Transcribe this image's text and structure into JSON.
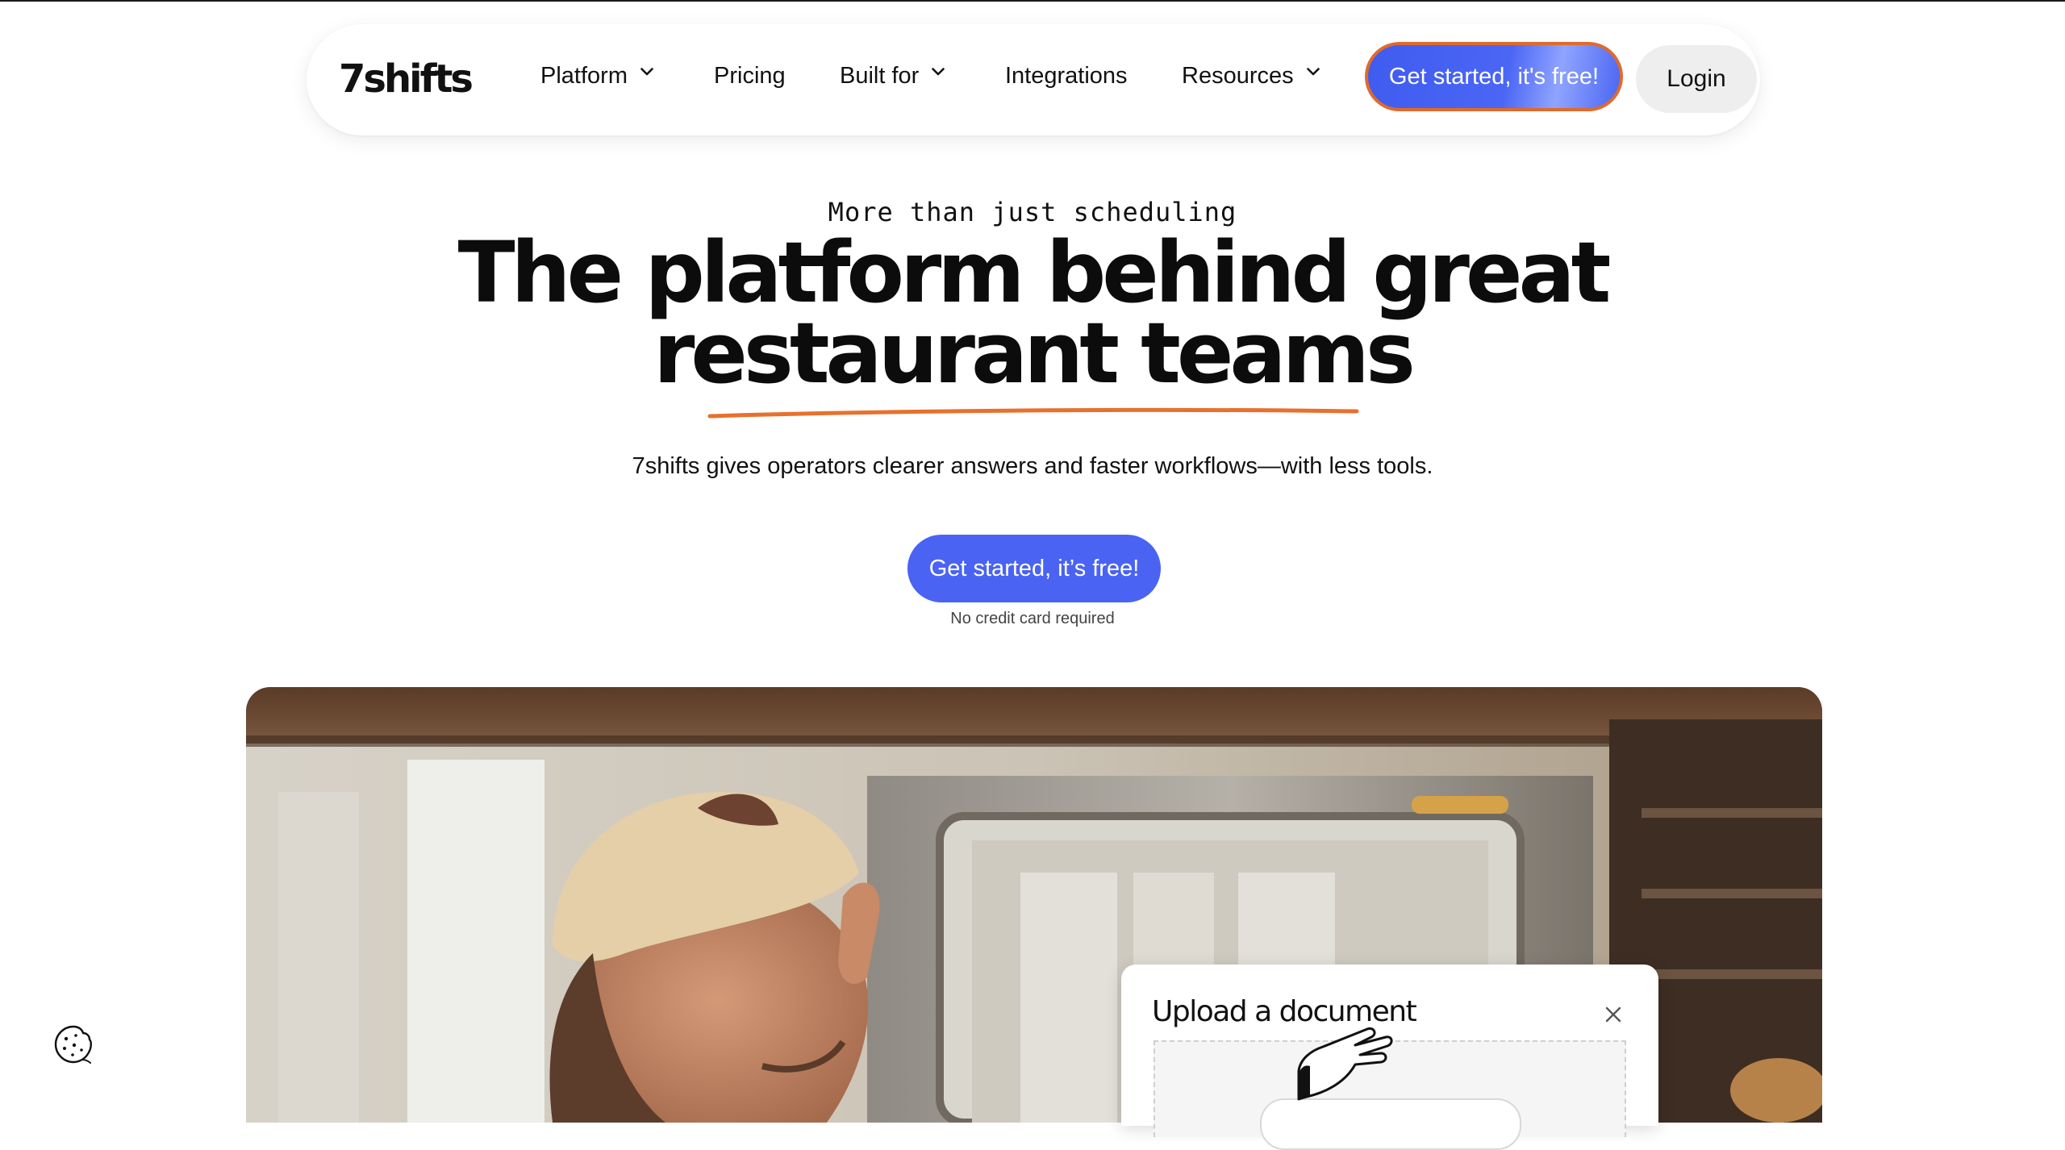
{
  "nav": {
    "logo": "7shifts",
    "items": [
      {
        "label": "Platform",
        "has_dropdown": true
      },
      {
        "label": "Pricing",
        "has_dropdown": false
      },
      {
        "label": "Built for",
        "has_dropdown": true
      },
      {
        "label": "Integrations",
        "has_dropdown": false
      },
      {
        "label": "Resources",
        "has_dropdown": true
      }
    ],
    "cta_label": "Get started, it's free!",
    "login_label": "Login"
  },
  "hero": {
    "kicker": "More than just scheduling",
    "headline_line1": "The platform behind great",
    "headline_line2": "restaurant teams",
    "subtitle": "7shifts gives operators clearer answers and faster workflows—with less tools.",
    "cta_label": "Get started, it’s free!",
    "note": "No credit card required"
  },
  "upload_card": {
    "title": "Upload a document"
  },
  "colors": {
    "accent_blue": "#4a63f2",
    "accent_orange": "#e06a2c",
    "login_bg": "#eeeeee"
  },
  "icons": {
    "dropdown": "chevron-down-icon",
    "close": "close-icon",
    "cookie": "cookie-icon",
    "hand": "hand-pointer-icon"
  }
}
